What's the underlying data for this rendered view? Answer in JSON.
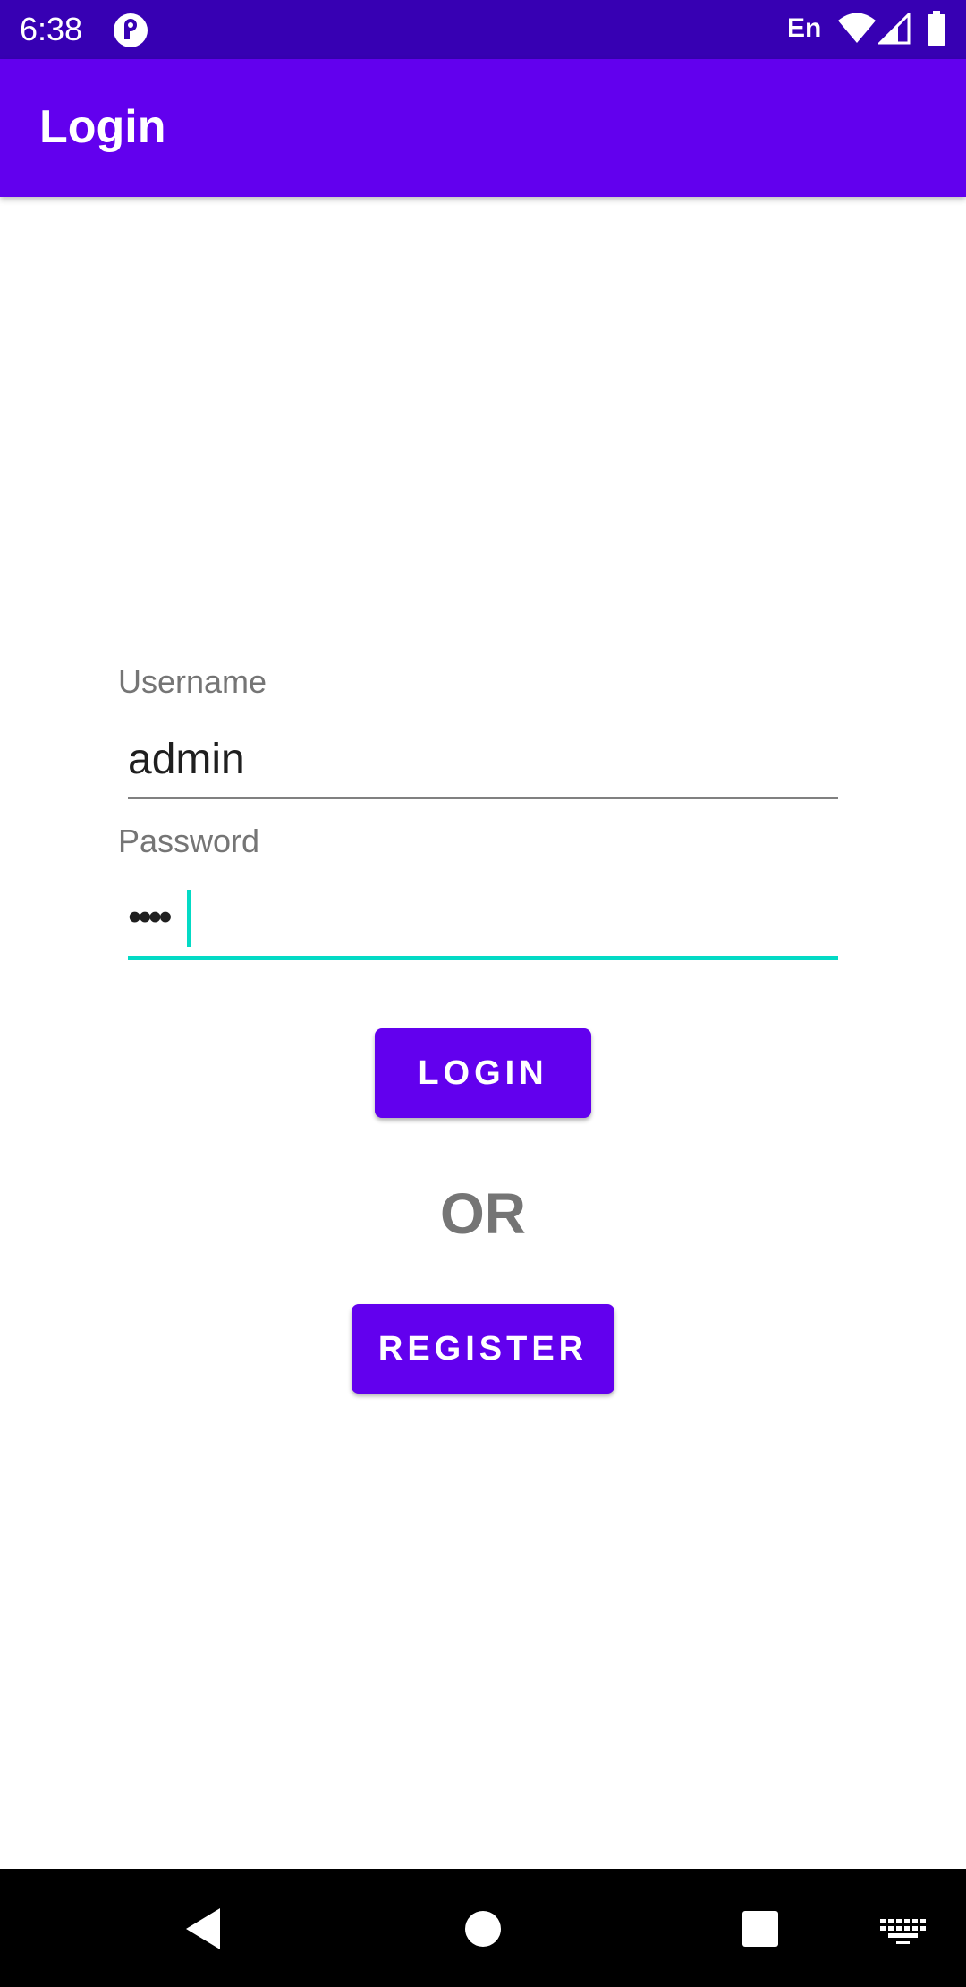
{
  "status_bar": {
    "time": "6:38",
    "language": "En",
    "icons": [
      "app-notification-icon",
      "wifi-icon",
      "cell-signal-icon",
      "battery-icon"
    ]
  },
  "app_bar": {
    "title": "Login"
  },
  "form": {
    "username_label": "Username",
    "username_value": "admin",
    "password_label": "Password",
    "password_value": "••••",
    "login_button": "LOGIN",
    "or_text": "OR",
    "register_button": "REGISTER"
  },
  "nav_bar": {
    "icons": [
      "back-icon",
      "home-icon",
      "recents-icon",
      "keyboard-icon"
    ]
  },
  "colors": {
    "status_bar": "#3700b3",
    "primary": "#6200ee",
    "accent": "#03dac5",
    "secondary_text": "#757575"
  }
}
